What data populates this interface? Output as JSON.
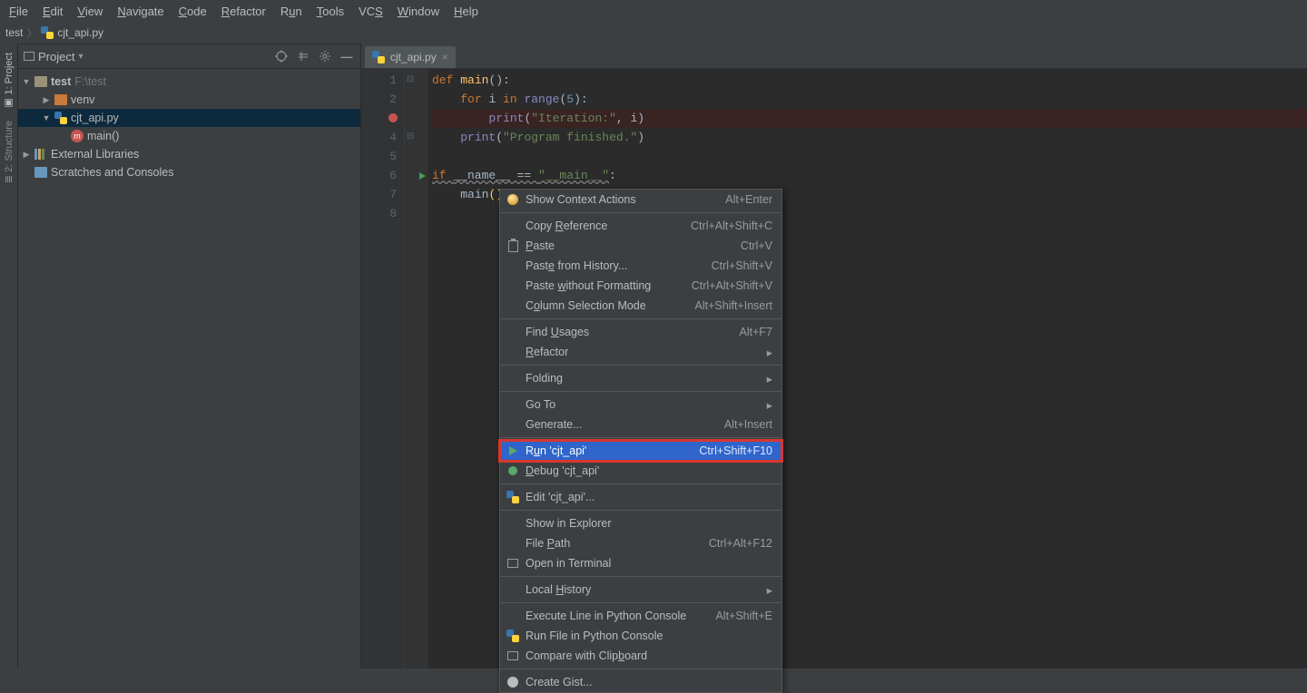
{
  "menu": [
    "File",
    "Edit",
    "View",
    "Navigate",
    "Code",
    "Refactor",
    "Run",
    "Tools",
    "VCS",
    "Window",
    "Help"
  ],
  "breadcrumbs": {
    "root": "test",
    "file": "cjt_api.py"
  },
  "project_panel": {
    "title": "Project",
    "tree": {
      "root": {
        "name": "test",
        "path": "F:\\test"
      },
      "venv": "venv",
      "file": "cjt_api.py",
      "func": "main()",
      "ext_libs": "External Libraries",
      "scratches": "Scratches and Consoles"
    }
  },
  "left_tabs": {
    "project": "1: Project",
    "structure": "2: Structure"
  },
  "editor": {
    "tab": "cjt_api.py",
    "lines": [
      "def main():",
      "    for i in range(5):",
      "        print(\"Iteration:\", i)",
      "    print(\"Program finished.\")",
      "",
      "if __name__ == \"__main__\":",
      "    main()",
      ""
    ],
    "breakpoint_line": 3,
    "run_gutter_line": 6
  },
  "context_menu": [
    {
      "icon": "bulb",
      "label": "Show Context Actions",
      "shortcut": "Alt+Enter"
    },
    {
      "sep": true
    },
    {
      "label": "Copy Reference",
      "u": "R",
      "shortcut": "Ctrl+Alt+Shift+C"
    },
    {
      "icon": "paste",
      "label": "Paste",
      "u": "P",
      "shortcut": "Ctrl+V"
    },
    {
      "label": "Paste from History...",
      "u": "e",
      "shortcut": "Ctrl+Shift+V"
    },
    {
      "label": "Paste without Formatting",
      "u": "w",
      "shortcut": "Ctrl+Alt+Shift+V"
    },
    {
      "label": "Column Selection Mode",
      "u": "o",
      "shortcut": "Alt+Shift+Insert"
    },
    {
      "sep": true
    },
    {
      "label": "Find Usages",
      "u": "U",
      "shortcut": "Alt+F7"
    },
    {
      "label": "Refactor",
      "u": "R",
      "submenu": true
    },
    {
      "sep": true
    },
    {
      "label": "Folding",
      "submenu": true
    },
    {
      "sep": true
    },
    {
      "label": "Go To",
      "submenu": true
    },
    {
      "label": "Generate...",
      "shortcut": "Alt+Insert"
    },
    {
      "sep": true
    },
    {
      "icon": "run",
      "label": "Run 'cjt_api'",
      "u": "u",
      "shortcut": "Ctrl+Shift+F10",
      "selected": true,
      "highlight": true
    },
    {
      "icon": "bug",
      "label": "Debug 'cjt_api'",
      "u": "D"
    },
    {
      "sep": true
    },
    {
      "icon": "py",
      "label": "Edit 'cjt_api'..."
    },
    {
      "sep": true
    },
    {
      "label": "Show in Explorer"
    },
    {
      "label": "File Path",
      "u": "P",
      "shortcut": "Ctrl+Alt+F12"
    },
    {
      "icon": "term",
      "label": "Open in Terminal"
    },
    {
      "sep": true
    },
    {
      "label": "Local History",
      "u": "H",
      "submenu": true
    },
    {
      "sep": true
    },
    {
      "label": "Execute Line in Python Console",
      "shortcut": "Alt+Shift+E"
    },
    {
      "icon": "py",
      "label": "Run File in Python Console"
    },
    {
      "icon": "cmp",
      "label": "Compare with Clipboard",
      "u": "b"
    },
    {
      "sep": true
    },
    {
      "icon": "gh",
      "label": "Create Gist..."
    }
  ]
}
